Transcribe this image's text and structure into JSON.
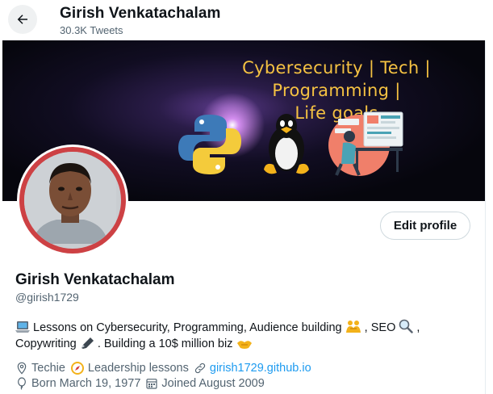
{
  "header": {
    "name": "Girish Venkatachalam",
    "tweet_count": "30.3K Tweets"
  },
  "banner": {
    "line1": "Cybersecurity | Tech | Programming |",
    "line2": "Life goals"
  },
  "profile": {
    "name": "Girish Venkatachalam",
    "handle": "@girish1729",
    "edit_label": "Edit profile",
    "bio_part1": "Lessons on Cybersecurity, Programming, Audience building",
    "bio_part2": ", SEO",
    "bio_part3": ",",
    "bio_part4": "Copywriting",
    "bio_part5": ". Building a 10$ million biz",
    "location": "Techie",
    "location_suffix": "Leadership lessons",
    "website": "girish1729.github.io",
    "born": "Born March 19, 1977",
    "joined": "Joined August 2009"
  },
  "colors": {
    "accent": "#1d9bf0",
    "avatar_ring": "#cd4144",
    "banner_text": "#f5c242"
  },
  "icons": {
    "back": "arrow-left-icon",
    "bio_laptop": "laptop-emoji",
    "bio_handshake": "handshake-emoji",
    "bio_magnifier": "magnifying-glass-emoji",
    "bio_pen": "pen-emoji",
    "location": "location-pin-icon",
    "leadership": "compass-emoji",
    "link": "link-icon",
    "birthday": "balloon-icon",
    "calendar": "calendar-icon"
  }
}
